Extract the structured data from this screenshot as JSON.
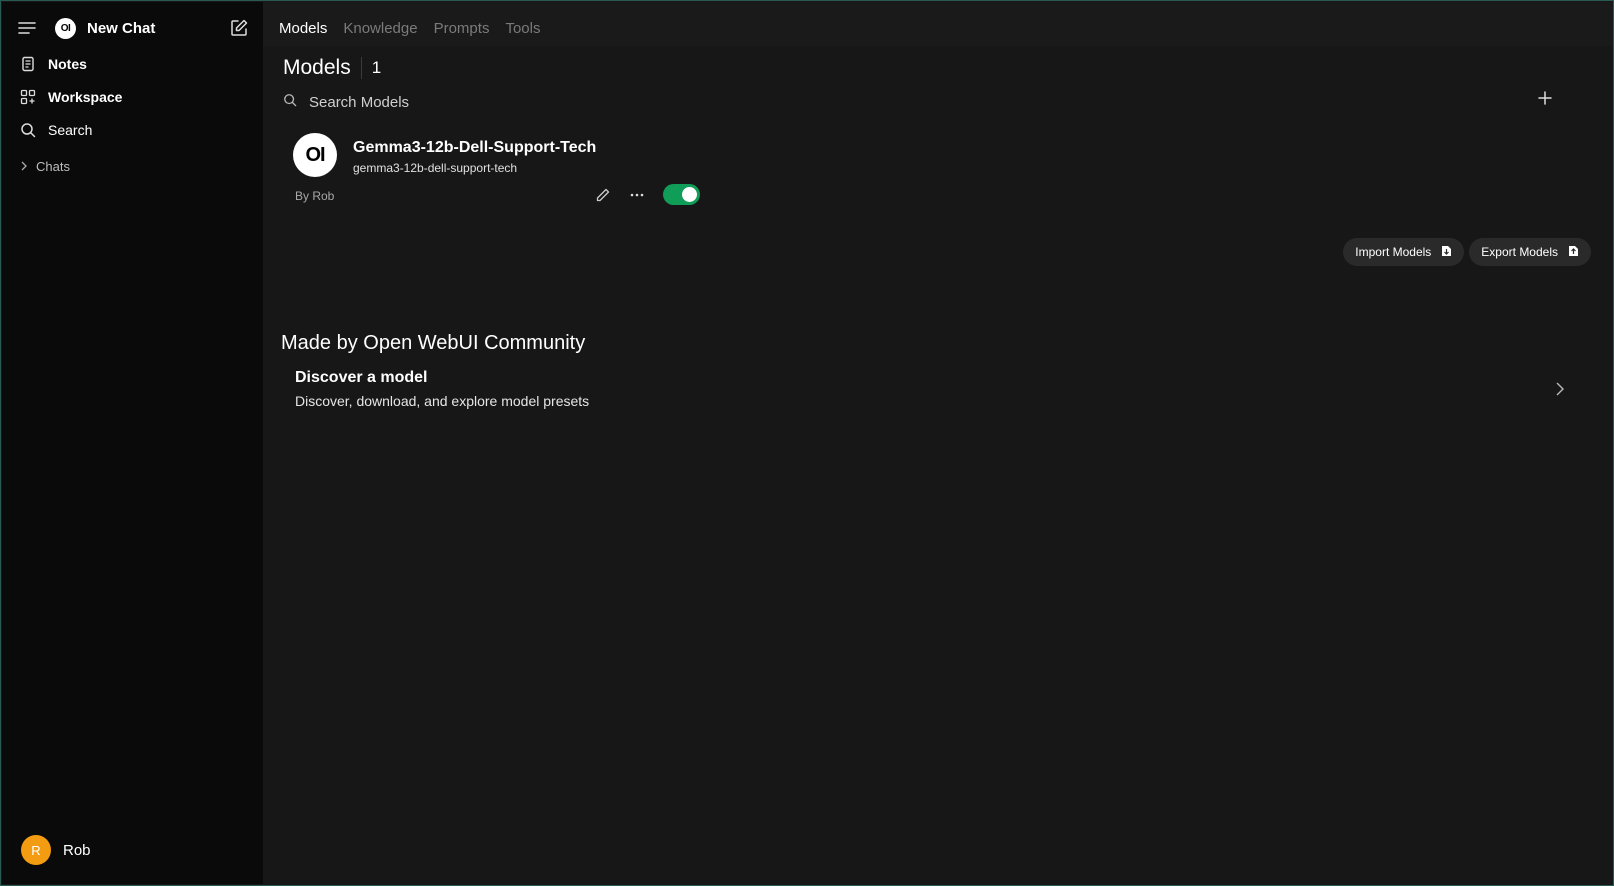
{
  "sidebar": {
    "logo_text": "OI",
    "new_chat": "New Chat",
    "items": [
      {
        "label": "Notes",
        "icon": "notes-icon"
      },
      {
        "label": "Workspace",
        "icon": "workspace-icon"
      },
      {
        "label": "Search",
        "icon": "search-icon"
      }
    ],
    "chats_group": "Chats",
    "user": {
      "initial": "R",
      "name": "Rob",
      "avatar_color": "#f39c12"
    }
  },
  "tabs": [
    {
      "label": "Models",
      "active": true
    },
    {
      "label": "Knowledge",
      "active": false
    },
    {
      "label": "Prompts",
      "active": false
    },
    {
      "label": "Tools",
      "active": false
    }
  ],
  "page": {
    "title": "Models",
    "count": "1"
  },
  "search": {
    "placeholder": "Search Models"
  },
  "model": {
    "logo_text": "OI",
    "name": "Gemma3-12b-Dell-Support-Tech",
    "id": "gemma3-12b-dell-support-tech",
    "author": "By Rob",
    "enabled": true,
    "toggle_color": "#0f9d58"
  },
  "actions": {
    "import": "Import Models",
    "export": "Export Models"
  },
  "community": {
    "title": "Made by Open WebUI Community",
    "discover_title": "Discover a model",
    "discover_sub": "Discover, download, and explore model presets"
  }
}
